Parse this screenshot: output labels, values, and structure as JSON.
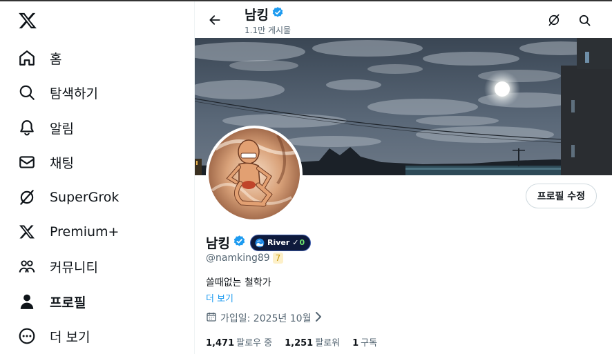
{
  "sidebar": {
    "logo_icon": "x-logo-icon",
    "items": [
      {
        "label": "홈",
        "icon": "home-icon"
      },
      {
        "label": "탐색하기",
        "icon": "search-icon"
      },
      {
        "label": "알림",
        "icon": "bell-icon"
      },
      {
        "label": "채팅",
        "icon": "envelope-icon"
      },
      {
        "label": "SuperGrok",
        "icon": "grok-icon"
      },
      {
        "label": "Premium+",
        "icon": "x-logo-icon"
      },
      {
        "label": "커뮤니티",
        "icon": "communities-icon"
      },
      {
        "label": "프로필",
        "icon": "person-icon",
        "active": true
      },
      {
        "label": "더 보기",
        "icon": "more-circle-icon"
      }
    ]
  },
  "header": {
    "name": "남킹",
    "post_count": "1.1만 게시물"
  },
  "profile": {
    "name": "남킹",
    "handle": "@namking89",
    "handle_badge": "7",
    "river_badge": {
      "label": "River",
      "check": "✓",
      "count": "0"
    },
    "bio": "쓸때없는 철학가",
    "more_link": "더 보기",
    "joined": "가입일: 2025년 10월",
    "edit_button": "프로필 수정",
    "stats": [
      {
        "count": "1,471",
        "label": "팔로우 중"
      },
      {
        "count": "1,251",
        "label": "팔로워"
      },
      {
        "count": "1",
        "label": "구독"
      }
    ]
  },
  "colors": {
    "accent": "#1d9bf0",
    "text": "#0f1419",
    "muted": "#536471",
    "verified": "#1d9bf0"
  }
}
